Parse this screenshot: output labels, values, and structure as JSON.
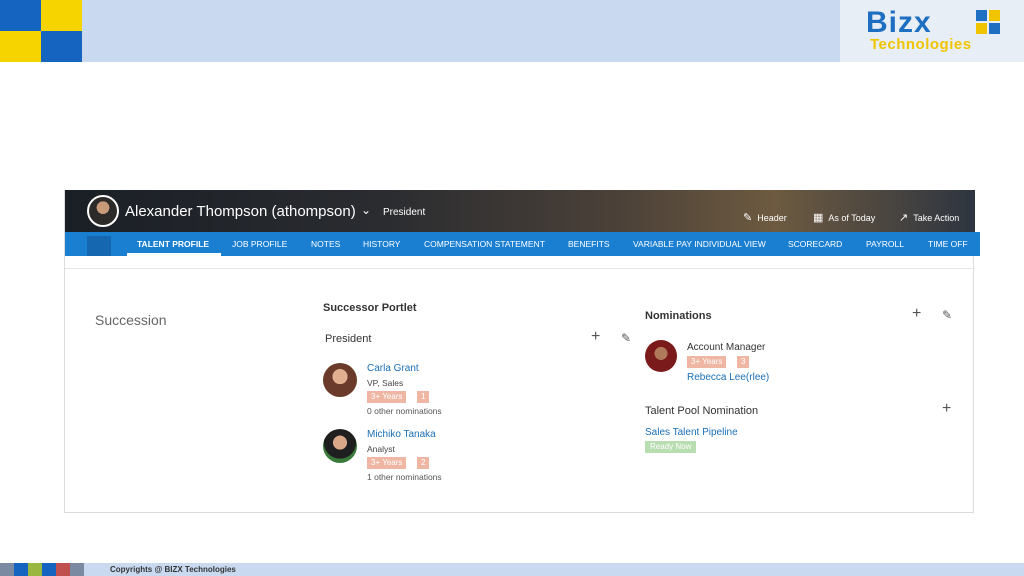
{
  "brand": {
    "logo_word": "Bizx",
    "logo_sub": "Technologies",
    "primary_color": "#1e6fc2",
    "accent_color": "#f0c400"
  },
  "profile": {
    "name": "Alexander Thompson (athompson)",
    "title": "President",
    "actions": [
      {
        "label": "Header",
        "icon": "pencil-icon"
      },
      {
        "label": "As of Today",
        "icon": "calendar-icon"
      },
      {
        "label": "Take Action",
        "icon": "share-icon"
      }
    ]
  },
  "tabs": [
    {
      "label": "TALENT PROFILE",
      "active": true
    },
    {
      "label": "JOB PROFILE"
    },
    {
      "label": "NOTES"
    },
    {
      "label": "HISTORY"
    },
    {
      "label": "COMPENSATION STATEMENT"
    },
    {
      "label": "BENEFITS"
    },
    {
      "label": "VARIABLE PAY INDIVIDUAL VIEW"
    },
    {
      "label": "SCORECARD"
    },
    {
      "label": "PAYROLL"
    },
    {
      "label": "TIME OFF"
    }
  ],
  "succession": {
    "section_title": "Succession",
    "portlet_title": "Successor Portlet",
    "role": "President",
    "candidates": [
      {
        "name": "Carla Grant",
        "role": "VP, Sales",
        "years": "3+ Years",
        "rank": "1",
        "other": "0 other nominations"
      },
      {
        "name": "Michiko Tanaka",
        "role": "Analyst",
        "years": "3+ Years",
        "rank": "2",
        "other": "1 other nominations"
      }
    ]
  },
  "nominations": {
    "title": "Nominations",
    "role": "Account Manager",
    "years": "3+ Years",
    "rank": "3",
    "person": "Rebecca Lee(rlee)",
    "pool_title": "Talent Pool Nomination",
    "pool_link": "Sales Talent Pipeline",
    "pool_status": "Ready Now"
  },
  "footer": {
    "copyright": "Copyrights @ BIZX Technologies"
  }
}
